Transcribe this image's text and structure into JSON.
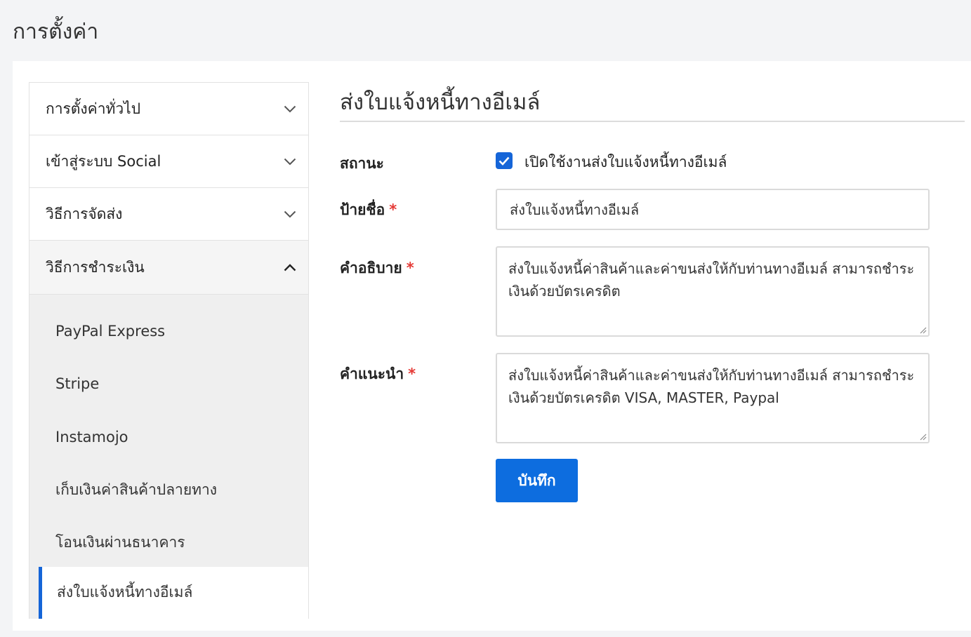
{
  "page": {
    "title": "การตั้งค่า"
  },
  "sidebar": {
    "sections": [
      {
        "label": "การตั้งค่าทั่วไป",
        "expanded": false
      },
      {
        "label": "เข้าสู่ระบบ Social",
        "expanded": false
      },
      {
        "label": "วิธีการจัดส่ง",
        "expanded": false
      },
      {
        "label": "วิธีการชำระเงิน",
        "expanded": true
      }
    ],
    "payment_methods": [
      "PayPal Express",
      "Stripe",
      "Instamojo",
      "เก็บเงินค่าสินค้าปลายทาง",
      "โอนเงินผ่านธนาคาร",
      "ส่งใบแจ้งหนี้ทางอีเมล์"
    ],
    "active_method": "ส่งใบแจ้งหนี้ทางอีเมล์"
  },
  "form": {
    "heading": "ส่งใบแจ้งหนี้ทางอีเมล์",
    "status_label": "สถานะ",
    "status_checkbox_label": "เปิดใช้งานส่งใบแจ้งหนี้ทางอีเมล์",
    "status_checked": true,
    "name_label": "ป้ายชื่อ",
    "name_value": "ส่งใบแจ้งหนี้ทางอีเมล์",
    "description_label": "คำอธิบาย",
    "description_value": "ส่งใบแจ้งหนี้ค่าสินค้าและค่าขนส่งให้กับท่านทางอีเมล์ สามารถชำระเงินด้วยบัตรเครดิต",
    "instructions_label": "คำแนะนำ",
    "instructions_value": "ส่งใบแจ้งหนี้ค่าสินค้าและค่าขนส่งให้กับท่านทางอีเมล์ สามารถชำระเงินด้วยบัตรเครดิต VISA, MASTER, Paypal",
    "required_marker": "*",
    "save_label": "บันทึก"
  },
  "colors": {
    "accent": "#0d6ddf",
    "required": "#e53935"
  }
}
